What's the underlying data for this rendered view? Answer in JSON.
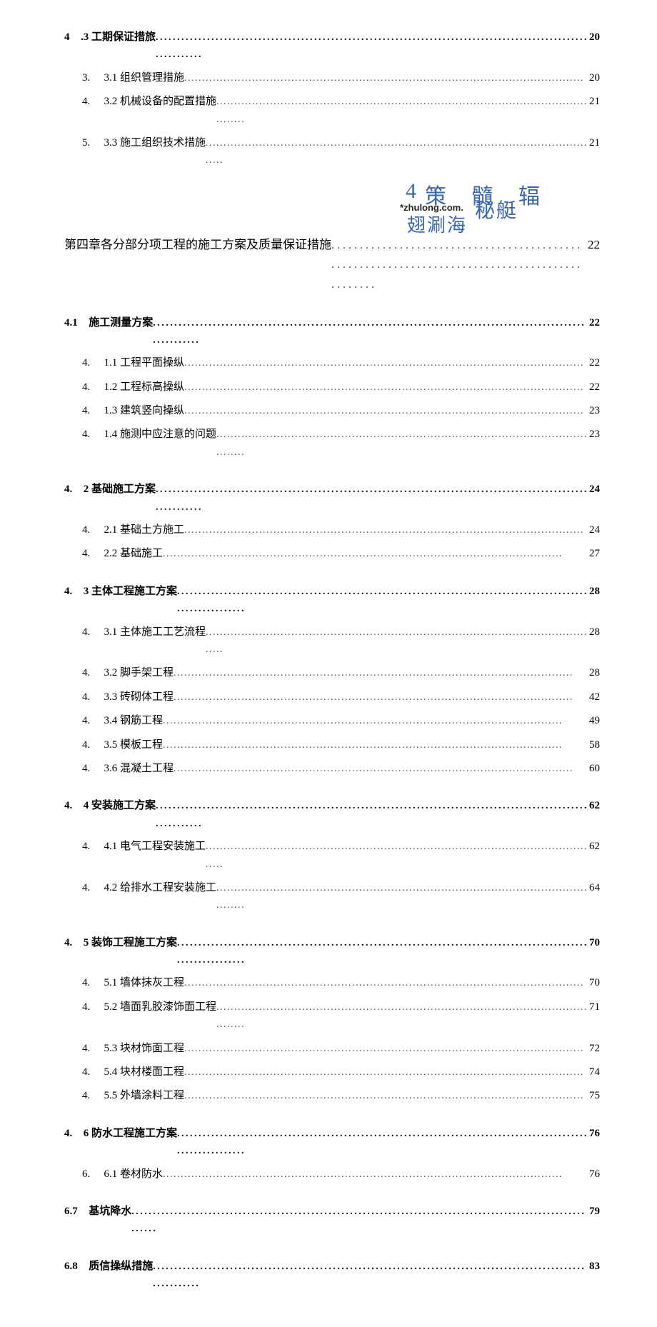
{
  "watermark": {
    "big4": "4",
    "row1": "策 髓 辐",
    "url": "*zhulong.com.",
    "row2": "秘艇",
    "row3": "翅涮海"
  },
  "chapter": {
    "label": "第四章各分部分项工程的施工方案及质量保证措施",
    "page": "22"
  },
  "sections": [
    {
      "heading": {
        "num": "4",
        "label": ".3 工期保证措旅",
        "page": "20"
      },
      "items": [
        {
          "num": "3.",
          "label": "3.1 组织管理措施",
          "page": "20"
        },
        {
          "num": "4.",
          "label": "3.2 机械设备的配置措施",
          "page": "21"
        },
        {
          "num": "5.",
          "label": "3.3 施工组织技术措施",
          "page": "21"
        }
      ]
    },
    {
      "heading": {
        "num": "4.1",
        "label": "施工测量方案",
        "page": "22"
      },
      "items": [
        {
          "num": "4.",
          "label": "1.1 工程平面操纵",
          "page": "22"
        },
        {
          "num": "4.",
          "label": "1.2 工程标高操纵",
          "page": "22"
        },
        {
          "num": "4.",
          "label": "1.3 建筑竖向操纵",
          "page": "23"
        },
        {
          "num": "4.",
          "label": "1.4 施测中应注意的问题",
          "page": "23"
        }
      ]
    },
    {
      "heading": {
        "num": "4.",
        "label": "2 基础施工方案",
        "page": "24"
      },
      "items": [
        {
          "num": "4.",
          "label": "2.1 基础土方施工",
          "page": "24"
        },
        {
          "num": "4.",
          "label": "2.2 基础施工",
          "page": "27"
        }
      ]
    },
    {
      "heading": {
        "num": "4.",
        "label": "3 主体工程施工方案",
        "page": "28"
      },
      "items": [
        {
          "num": "4.",
          "label": "3.1 主体施工工艺流程",
          "page": "28"
        },
        {
          "num": "4.",
          "label": "3.2 脚手架工程",
          "page": "28"
        },
        {
          "num": "4.",
          "label": "3.3 砖砌体工程",
          "page": "42"
        },
        {
          "num": "4.",
          "label": "3.4 钢筋工程",
          "page": "49"
        },
        {
          "num": "4.",
          "label": "3.5 模板工程",
          "page": "58"
        },
        {
          "num": "4.",
          "label": "3.6 混凝土工程",
          "page": "60"
        }
      ]
    },
    {
      "heading": {
        "num": "4.",
        "label": "4 安装施工方案",
        "page": "62"
      },
      "items": [
        {
          "num": "4.",
          "label": "4.1 电气工程安装施工",
          "page": "62"
        },
        {
          "num": "4.",
          "label": "4.2 给排水工程安装施工",
          "page": "64"
        }
      ]
    },
    {
      "heading": {
        "num": "4.",
        "label": "5 装饰工程施工方案",
        "page": "70"
      },
      "items": [
        {
          "num": "4.",
          "label": "5.1 墙体抹灰工程",
          "page": "70"
        },
        {
          "num": "4.",
          "label": "5.2 墙面乳胶漆饰面工程",
          "page": "71"
        },
        {
          "num": "4.",
          "label": "5.3 块材饰面工程",
          "page": "72"
        },
        {
          "num": "4.",
          "label": "5.4 块材楼面工程",
          "page": "74"
        },
        {
          "num": "4.",
          "label": "5.5 外墙涂料工程",
          "page": "75"
        }
      ]
    },
    {
      "heading": {
        "num": "4.",
        "label": "6 防水工程施工方案",
        "page": "76"
      },
      "items": [
        {
          "num": "6.",
          "label": "6.1 卷材防水",
          "page": "76"
        }
      ]
    },
    {
      "heading": {
        "num": "6.7",
        "label": "基坑降水",
        "page": "79"
      },
      "items": []
    },
    {
      "heading": {
        "num": "6.8",
        "label": "质信操纵措施",
        "page": "83"
      },
      "items": []
    }
  ]
}
